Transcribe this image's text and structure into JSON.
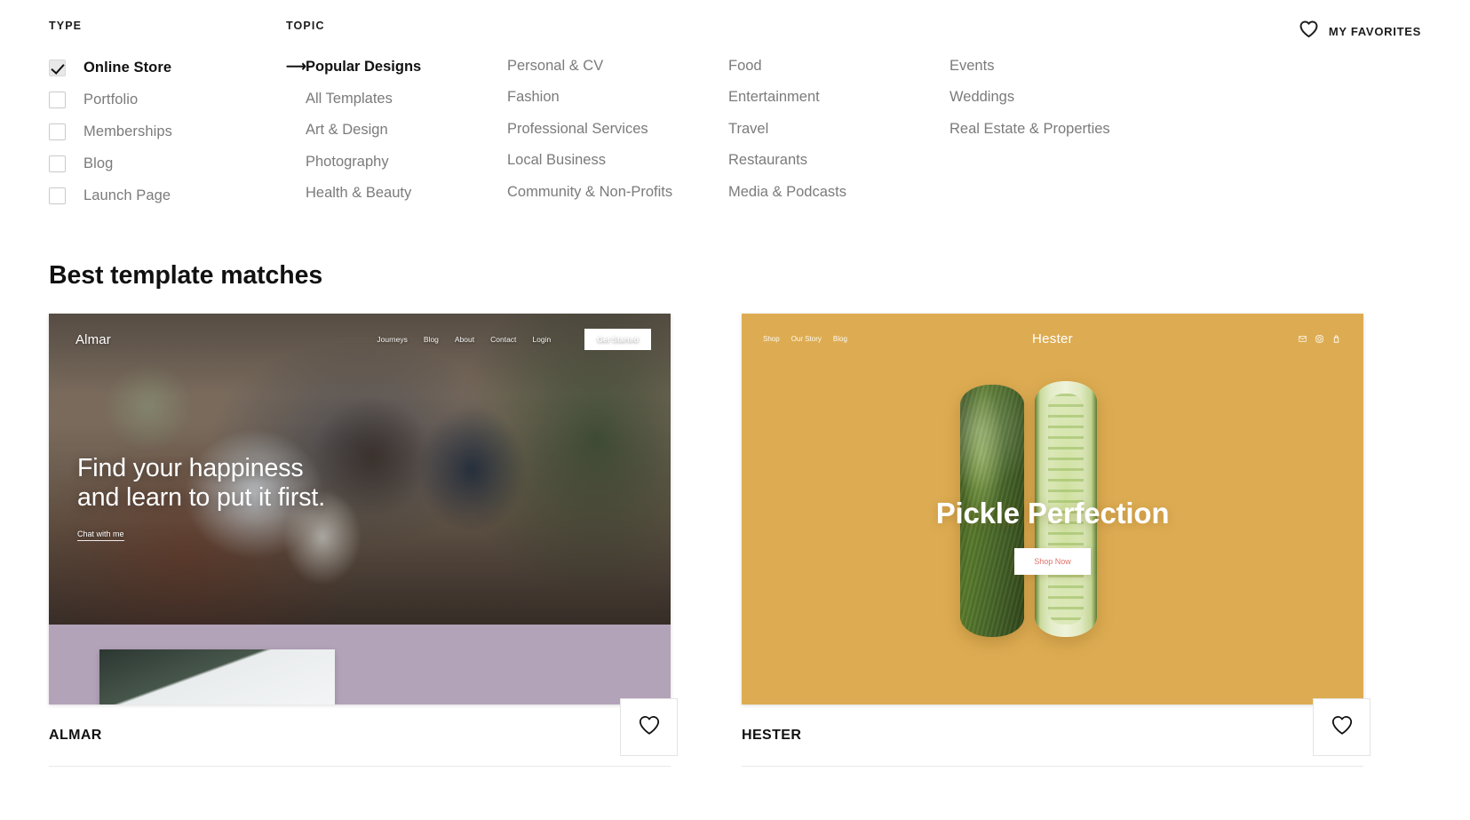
{
  "filters": {
    "type_label": "TYPE",
    "topic_label": "TOPIC",
    "types": [
      {
        "label": "Online Store",
        "checked": true
      },
      {
        "label": "Portfolio",
        "checked": false
      },
      {
        "label": "Memberships",
        "checked": false
      },
      {
        "label": "Blog",
        "checked": false
      },
      {
        "label": "Launch Page",
        "checked": false
      }
    ],
    "topics_col1": [
      {
        "label": "Popular Designs",
        "active": true
      },
      {
        "label": "All Templates",
        "active": false
      },
      {
        "label": "Art & Design",
        "active": false
      },
      {
        "label": "Photography",
        "active": false
      },
      {
        "label": "Health & Beauty",
        "active": false
      }
    ],
    "topics_col2": [
      {
        "label": "Personal & CV"
      },
      {
        "label": "Fashion"
      },
      {
        "label": "Professional Services"
      },
      {
        "label": "Local Business"
      },
      {
        "label": "Community & Non-Profits"
      }
    ],
    "topics_col3": [
      {
        "label": "Food"
      },
      {
        "label": "Entertainment"
      },
      {
        "label": "Travel"
      },
      {
        "label": "Restaurants"
      },
      {
        "label": "Media & Podcasts"
      }
    ],
    "topics_col4": [
      {
        "label": "Events"
      },
      {
        "label": "Weddings"
      },
      {
        "label": "Real Estate & Properties"
      }
    ]
  },
  "header": {
    "favorites_label": "MY FAVORITES",
    "favorites_icon": "heart-outline-icon"
  },
  "main": {
    "section_title": "Best template matches"
  },
  "cards": [
    {
      "name": "ALMAR",
      "favorite_icon": "heart-outline-icon",
      "site": {
        "logo": "Almar",
        "nav": [
          "Journeys",
          "Blog",
          "About",
          "Contact",
          "Login"
        ],
        "cta": "Get Started",
        "headline": "Find your happiness\nand learn to put it first.",
        "link": "Chat with me",
        "band_color": "#b3a3b9"
      }
    },
    {
      "name": "HESTER",
      "favorite_icon": "heart-outline-icon",
      "site": {
        "logo": "Hester",
        "nav": [
          "Shop",
          "Our Story",
          "Blog"
        ],
        "icons": [
          "mail-icon",
          "instagram-icon",
          "cart-icon"
        ],
        "headline": "Pickle Perfection",
        "button": "Shop Now",
        "background_color": "#ddac52",
        "button_text_color": "#e0726a"
      }
    }
  ]
}
